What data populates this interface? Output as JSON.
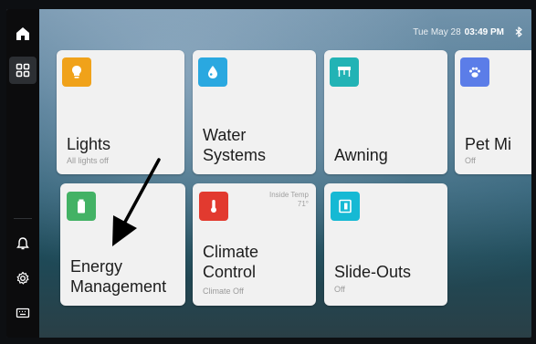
{
  "status": {
    "date": "Tue May 28",
    "time": "03:49 PM",
    "icon": "bluetooth-icon"
  },
  "sidebar": {
    "items": [
      {
        "name": "home",
        "icon": "home-icon"
      },
      {
        "name": "dashboard",
        "icon": "grid-icon",
        "active": true
      },
      {
        "name": "notifications",
        "icon": "bell-icon"
      },
      {
        "name": "settings",
        "icon": "gear-icon"
      },
      {
        "name": "keyboard",
        "icon": "keyboard-icon"
      }
    ]
  },
  "tiles": {
    "lights": {
      "title": "Lights",
      "subtitle": "All lights off",
      "icon": "lightbulb-icon",
      "color": "#f0a21a"
    },
    "water": {
      "title_line1": "Water",
      "title_line2": "Systems",
      "icon": "water-drop-icon",
      "color": "#2aa8e0"
    },
    "awning": {
      "title": "Awning",
      "icon": "awning-icon",
      "color": "#22b3b5"
    },
    "pet": {
      "title": "Pet Mi",
      "subtitle": "Off",
      "icon": "paw-icon",
      "color": "#5b7de8"
    },
    "energy": {
      "title_line1": "Energy",
      "title_line2": "Management",
      "icon": "battery-icon",
      "color": "#43b265"
    },
    "climate": {
      "title_line1": "Climate",
      "title_line2": "Control",
      "subtitle": "Climate Off",
      "corner_line1": "Inside Temp",
      "corner_line2": "71°",
      "icon": "thermometer-icon",
      "color": "#e23a2f"
    },
    "slideouts": {
      "title": "Slide-Outs",
      "subtitle": "Off",
      "icon": "slide-out-icon",
      "color": "#16b9d4"
    }
  }
}
